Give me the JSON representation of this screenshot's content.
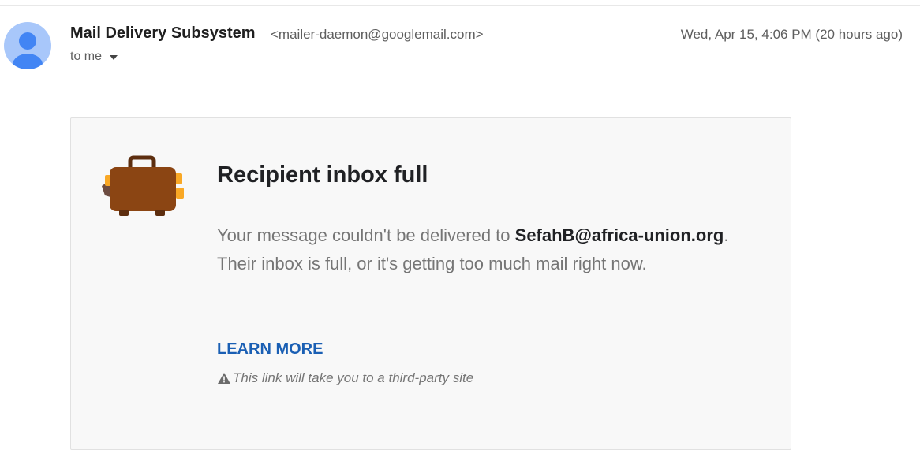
{
  "header": {
    "sender_name": "Mail Delivery Subsystem",
    "sender_email": "<mailer-daemon@googlemail.com>",
    "date": "Wed, Apr 15, 4:06 PM (20 hours ago)",
    "to_label": "to me"
  },
  "card": {
    "title": "Recipient inbox full",
    "message_prefix": "Your message couldn't be delivered to ",
    "recipient_address": "SefahB@africa-union.org",
    "message_suffix": ". Their inbox is full, or it's getting too much mail right now.",
    "learn_more_label": "LEARN MORE",
    "third_party_warning": "This link will take you to a third-party site"
  },
  "icons": {
    "avatar": "person-avatar-icon",
    "briefcase": "briefcase-icon",
    "warning": "warning-triangle-icon",
    "dropdown": "caret-down-icon"
  },
  "colors": {
    "link": "#1a5fb4",
    "avatar_bg": "#a8c7fa",
    "avatar_fg": "#4285f4",
    "briefcase_body": "#8b4513",
    "briefcase_accent": "#f9a825"
  }
}
